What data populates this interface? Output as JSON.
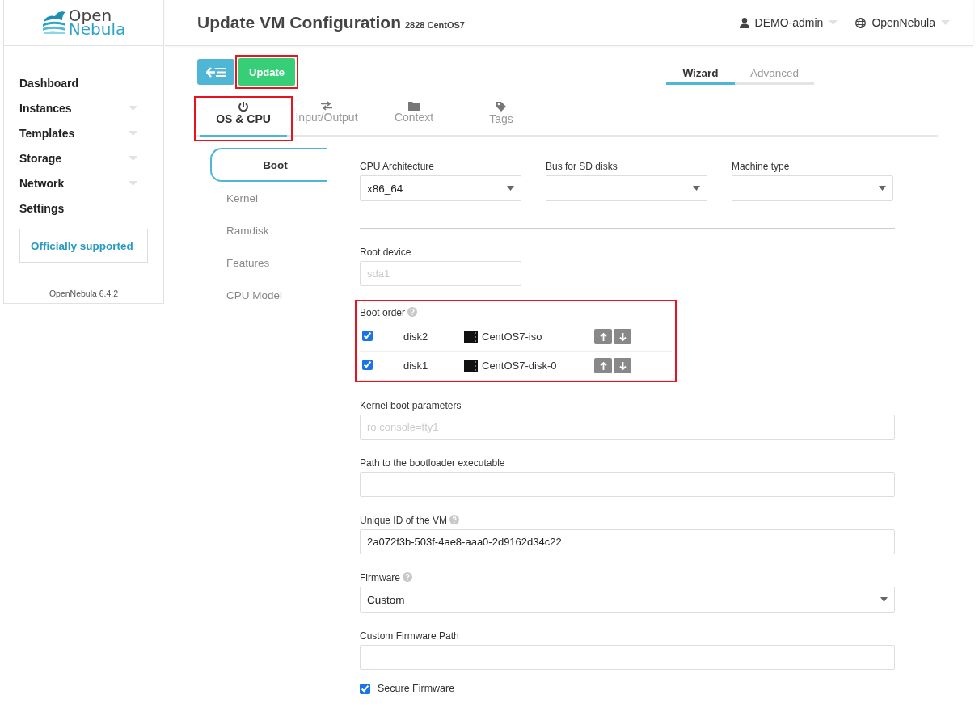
{
  "brand": {
    "line_1": "Open",
    "line_2": "Nebula"
  },
  "sidebar": {
    "items": [
      {
        "label": "Dashboard",
        "expandable": false
      },
      {
        "label": "Instances",
        "expandable": true
      },
      {
        "label": "Templates",
        "expandable": true
      },
      {
        "label": "Storage",
        "expandable": true
      },
      {
        "label": "Network",
        "expandable": true
      },
      {
        "label": "Settings",
        "expandable": false
      }
    ],
    "support_link": "Officially supported",
    "version": "OpenNebula 6.4.2"
  },
  "header": {
    "title": "Update VM Configuration",
    "vm_id": "2828",
    "vm_name": "CentOS7",
    "user": "DEMO-admin",
    "zone": "OpenNebula"
  },
  "toolbar": {
    "update_button": {
      "label": "Update",
      "highlighted": true
    },
    "modes": [
      {
        "label": "Wizard",
        "selected": true
      },
      {
        "label": "Advanced",
        "selected": false
      }
    ]
  },
  "tabs": [
    {
      "label": "OS & CPU",
      "selected": true,
      "highlighted": true
    },
    {
      "label": "Input/Output",
      "selected": false,
      "highlighted": false
    },
    {
      "label": "Context",
      "selected": false,
      "highlighted": false
    },
    {
      "label": "Tags",
      "selected": false,
      "highlighted": false
    }
  ],
  "subtabs": [
    {
      "label": "Boot",
      "selected": true
    },
    {
      "label": "Kernel",
      "selected": false
    },
    {
      "label": "Ramdisk",
      "selected": false
    },
    {
      "label": "Features",
      "selected": false
    },
    {
      "label": "CPU Model",
      "selected": false
    }
  ],
  "selects": [
    {
      "label": "CPU Architecture",
      "value": "x86_64"
    },
    {
      "label": "Bus for SD disks"
    },
    {
      "label": "Machine type"
    }
  ],
  "fields": [
    {
      "kind": "short-text",
      "label": "Root device",
      "placeholder": "sda1",
      "help": false
    },
    {
      "kind": "boot-order",
      "label": "Boot order",
      "help": true,
      "highlighted": true,
      "rows": [
        {
          "checked": true,
          "disk": "disk2",
          "image": "CentOS7-iso"
        },
        {
          "checked": true,
          "disk": "disk1",
          "image": "CentOS7-disk-0"
        }
      ]
    },
    {
      "kind": "text",
      "label": "Kernel boot parameters",
      "placeholder": "ro console=tty1",
      "help": false
    },
    {
      "kind": "text",
      "label": "Path to the bootloader executable",
      "help": false
    },
    {
      "kind": "text",
      "label": "Unique ID of the VM",
      "value": "2a072f3b-503f-4ae8-aaa0-2d9162d34c22",
      "help": true
    },
    {
      "kind": "select",
      "label": "Firmware",
      "value": "Custom",
      "help": true
    },
    {
      "kind": "text",
      "label": "Custom Firmware Path",
      "help": false
    },
    {
      "kind": "checkbox",
      "label": "Secure Firmware",
      "checked": true
    }
  ]
}
